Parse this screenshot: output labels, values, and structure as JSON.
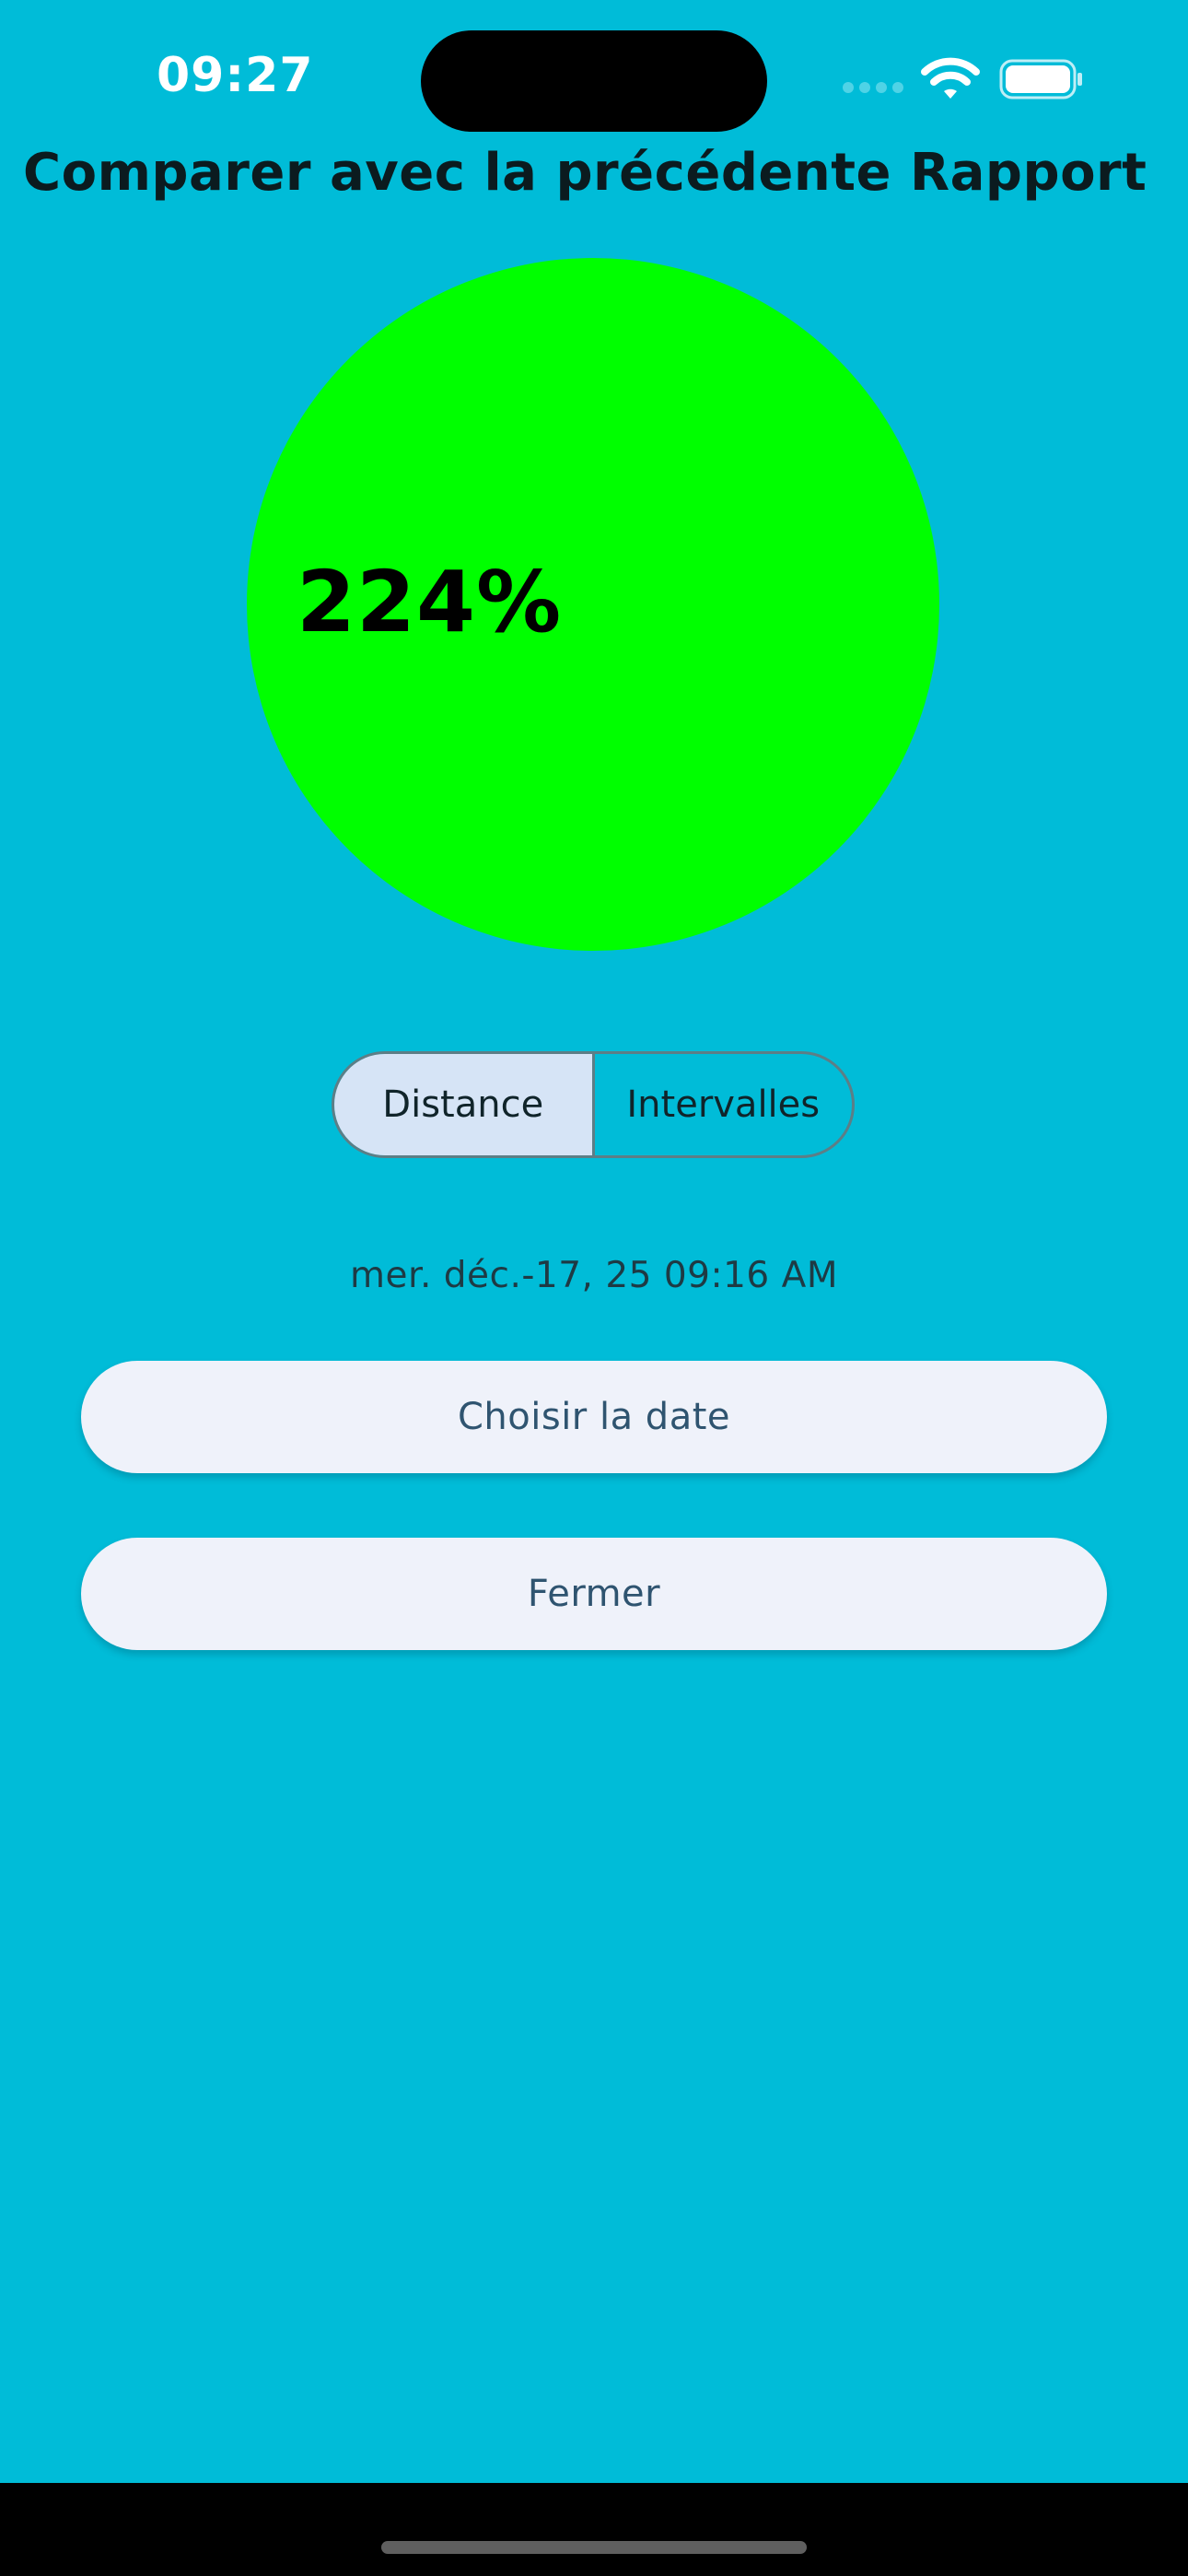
{
  "status_bar": {
    "time": "09:27",
    "icons": [
      "cellular-signal-icon",
      "wifi-icon",
      "battery-icon"
    ]
  },
  "header": {
    "title": "Comparer avec la précédente Rapport"
  },
  "gauge": {
    "value_label": "224%",
    "color": "#00FF00"
  },
  "segmented_control": {
    "options": [
      "Distance",
      "Intervalles"
    ],
    "selected": "Distance"
  },
  "report": {
    "date": "mer. déc.-17, 25 09:16 AM"
  },
  "buttons": {
    "choose_date": "Choisir la date",
    "close": "Fermer"
  },
  "colors": {
    "background": "#00BCD8",
    "selected_segment": "#D6E4F6",
    "button_bg": "#EFF2FA",
    "button_text": "#2F5470"
  }
}
